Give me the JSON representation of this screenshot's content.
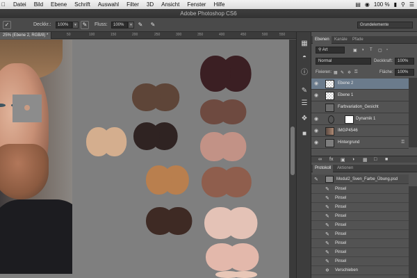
{
  "menubar": {
    "apple": "",
    "items": [
      "Fenster",
      "Hilfe"
    ],
    "items_left": [
      "Datei",
      "Bild",
      "Ebene",
      "Schrift",
      "Auswahl",
      "Filter",
      "3D",
      "Ansicht"
    ],
    "battery": "100 %",
    "status_icons": [
      "menu-extra-icon",
      "wifi-icon",
      "battery-icon",
      "search-icon",
      "list-icon"
    ]
  },
  "window": {
    "title": "Adobe Photoshop CS6"
  },
  "options": {
    "opacity_label": "Deckkr.:",
    "opacity_value": "100%",
    "flow_label": "Fluss:",
    "flow_value": "100%",
    "workspace": "Grundelemente"
  },
  "document": {
    "tab": "25% (Ebene 2, RGB/8) *"
  },
  "ruler": [
    "50",
    "100",
    "150",
    "200",
    "250",
    "300",
    "350",
    "400",
    "450",
    "500",
    "550",
    "600",
    "650"
  ],
  "layers_panel": {
    "tabs": [
      "Ebenen",
      "Kanäle",
      "Pfade"
    ],
    "filter_type": "Art",
    "blend_mode": "Normal",
    "opacity_label": "Deckkraft:",
    "opacity_value": "100%",
    "lock_label": "Fixieren:",
    "fill_label": "Fläche:",
    "fill_value": "100%",
    "layers": [
      {
        "name": "Ebene 2",
        "selected": true
      },
      {
        "name": "Ebene 1",
        "selected": false
      },
      {
        "name": "Farbvariation_Gesicht",
        "selected": false
      },
      {
        "name": "Dynamik 1",
        "selected": false
      },
      {
        "name": "IMGP4546",
        "selected": false
      },
      {
        "name": "Hintergrund",
        "selected": false
      }
    ]
  },
  "history_panel": {
    "tabs": [
      "Protokoll",
      "Aktionen"
    ],
    "snapshot": "Modul2_Sven_Farbe_Übung.psd",
    "steps": [
      "Pinsel",
      "Pinsel",
      "Pinsel",
      "Pinsel",
      "Pinsel",
      "Pinsel",
      "Pinsel",
      "Pinsel",
      "Pinsel",
      "Verschieben"
    ]
  },
  "colors": {
    "swatches": [
      "#3b1f23",
      "#5e4538",
      "#6e4a40",
      "#d4ae8e",
      "#2f2322",
      "#c29286",
      "#b97f4e",
      "#8f5e4d",
      "#3e2a24",
      "#e4c2b6",
      "#e3b8ab",
      "#e8c7b7"
    ]
  }
}
